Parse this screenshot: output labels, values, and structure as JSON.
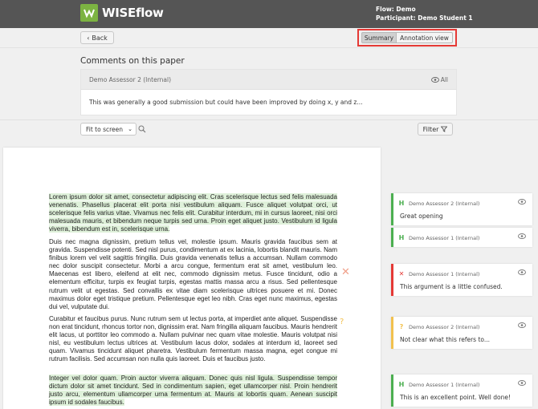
{
  "header": {
    "logo_text": "WISEflow",
    "flow_label": "Flow:",
    "flow_value": "Demo",
    "participant_label": "Participant:",
    "participant_value": "Demo Student 1"
  },
  "toolbar": {
    "back_label": "Back",
    "summary_label": "Summary",
    "annotation_label": "Annotation view"
  },
  "comments": {
    "title": "Comments on this paper",
    "author": "Demo Assessor 2 (Internal)",
    "visibility": "All",
    "text": "This was generally a good submission but could have been improved by doing x, y and z..."
  },
  "viewer": {
    "zoom_value": "Fit to screen",
    "filter_label": "Filter"
  },
  "document": {
    "p1": "Lorem ipsum dolor sit amet, consectetur adipiscing elit. Cras scelerisque lectus sed felis malesuada venenatis. Phasellus placerat elit porta nisi vestibulum aliquam. Fusce aliquet volutpat orci, ut scelerisque felis varius vitae. Vivamus nec felis elit. Curabitur interdum, mi in cursus laoreet, nisi orci malesuada mauris, et bibendum neque turpis sed urna. Proin eget aliquet justo. Vestibulum id ligula viverra, bibendum est in, scelerisque urna.",
    "p2": "Duis nec magna dignissim, pretium tellus vel, molestie ipsum. Mauris gravida faucibus sem at gravida. Suspendisse potenti. Sed nisl purus, condimentum at ex lacinia, lobortis blandit mauris. Nam finibus lorem vel velit sagittis fringilla. Duis gravida venenatis tellus a accumsan. Nullam commodo nec dolor suscipit consectetur. Morbi a arcu congue, fermentum erat sit amet, vestibulum leo. Maecenas est libero, eleifend at elit nec, commodo dignissim metus. Fusce tincidunt, odio a elementum efficitur, turpis ex feugiat turpis, egestas mattis massa arcu a risus. Sed pellentesque rutrum velit ut egestas. Sed convallis ex vitae diam scelerisque ultrices posuere et mi. Donec maximus dolor eget tristique pretium. Pellentesque eget leo nibh. Cras eget nunc maximus, egestas dui vel, vulputate dui.",
    "p3": "Curabitur et faucibus purus. Nunc rutrum sem ut lectus porta, at imperdiet ante aliquet. Suspendisse non erat tincidunt, rhoncus tortor non, dignissim erat. Nam fringilla aliquam faucibus. Mauris hendrerit elit lacus, ut porttitor leo commodo a. Nullam pulvinar nec quam vitae molestie. Mauris volutpat nisi nisl, eu vestibulum lectus ultrices at. Vestibulum lacus dolor, sodales at interdum id, laoreet sed quam. Vivamus tincidunt aliquet pharetra. Vestibulum fermentum massa magna, eget congue mi rutrum facilisis. Sed accumsan non nulla quis laoreet. Duis et faucibus justo.",
    "p4": "Integer vel dolor quam. Proin auctor viverra aliquam. Donec quis nisl ligula. Suspendisse tempor dictum dolor sit amet tincidunt. Sed in condimentum sapien, eget ullamcorper nisl. Proin hendrerit justo arcu, elementum ullamcorper urna fermentum at. Mauris at lobortis quam. Aenean suscipit ipsum id sodales faucibus."
  },
  "annotations": [
    {
      "author": "Demo Assessor 2 (Internal)",
      "text": "Great opening",
      "type": "highlight",
      "icon": "H"
    },
    {
      "author": "Demo Assessor 1 (Internal)",
      "text": "",
      "type": "highlight",
      "icon": "H"
    },
    {
      "author": "Demo Assessor 1 (Internal)",
      "text": "This argument is a little confused.",
      "type": "error",
      "icon": "✕"
    },
    {
      "author": "Demo Assessor 2 (Internal)",
      "text": "Not clear what this refers to...",
      "type": "question",
      "icon": "?"
    },
    {
      "author": "Demo Assessor 1 (Internal)",
      "text": "This is an excellent point. Well done!",
      "type": "highlight",
      "icon": "H"
    }
  ],
  "colors": {
    "brand_green": "#7cb342",
    "header_bg": "#555555",
    "highlight_bg": "#dff1da",
    "error_red": "#e53935",
    "question_yellow": "#f2c14e"
  }
}
